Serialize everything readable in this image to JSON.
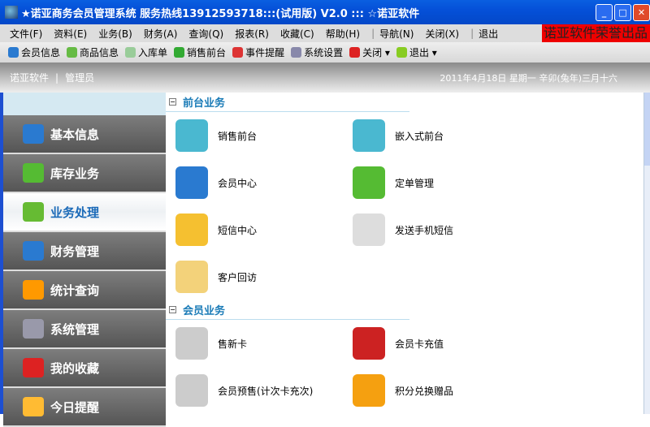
{
  "window": {
    "title": "★诺亚商务会员管理系统 服务热线13912593718:::(试用版) V2.0  ::: ☆诺亚软件"
  },
  "menu": [
    "文件(F)",
    "资料(E)",
    "业务(B)",
    "财务(A)",
    "查询(Q)",
    "报表(R)",
    "收藏(C)",
    "帮助(H)",
    "导航(N)",
    "关闭(X)",
    "退出"
  ],
  "promo": "诺亚软件荣誉出品",
  "toolbar": [
    {
      "label": "会员信息",
      "color": "#2a7ad0"
    },
    {
      "label": "商品信息",
      "color": "#6b4"
    },
    {
      "label": "入库单",
      "color": "#9c9"
    },
    {
      "label": "销售前台",
      "color": "#3a3"
    },
    {
      "label": "事件提醒",
      "color": "#d33"
    },
    {
      "label": "系统设置",
      "color": "#88a"
    },
    {
      "label": "关闭 ▾",
      "color": "#d22"
    },
    {
      "label": "退出 ▾",
      "color": "#8c2"
    }
  ],
  "banner": {
    "company": "诺亚软件",
    "user": "管理员",
    "date": "2011年4月18日   星期一   辛卯(兔年)三月十六"
  },
  "nav": [
    {
      "label": "基本信息",
      "color": "#2a7ad0"
    },
    {
      "label": "库存业务",
      "color": "#5b3"
    },
    {
      "label": "业务处理",
      "color": "#6b3"
    },
    {
      "label": "财务管理",
      "color": "#2a7ad0"
    },
    {
      "label": "统计查询",
      "color": "#f90"
    },
    {
      "label": "系统管理",
      "color": "#99a"
    },
    {
      "label": "我的收藏",
      "color": "#d22"
    },
    {
      "label": "今日提醒",
      "color": "#fb3"
    }
  ],
  "sections": [
    {
      "title": "前台业务",
      "items": [
        {
          "label": "销售前台",
          "color": "#4ab8d0"
        },
        {
          "label": "嵌入式前台",
          "color": "#4ab8d0"
        },
        {
          "label": "会员中心",
          "color": "#2a7ad0"
        },
        {
          "label": "定单管理",
          "color": "#5b3"
        },
        {
          "label": "短信中心",
          "color": "#f5c030"
        },
        {
          "label": "发送手机短信",
          "color": "#ddd"
        },
        {
          "label": "客户回访",
          "color": "#f3d27a"
        }
      ]
    },
    {
      "title": "会员业务",
      "items": [
        {
          "label": "售新卡",
          "color": "#ccc"
        },
        {
          "label": "会员卡充值",
          "color": "#c22"
        },
        {
          "label": "会员预售(计次卡充次)",
          "color": "#ccc"
        },
        {
          "label": "积分兑换赠品",
          "color": "#f5a010"
        }
      ]
    }
  ]
}
